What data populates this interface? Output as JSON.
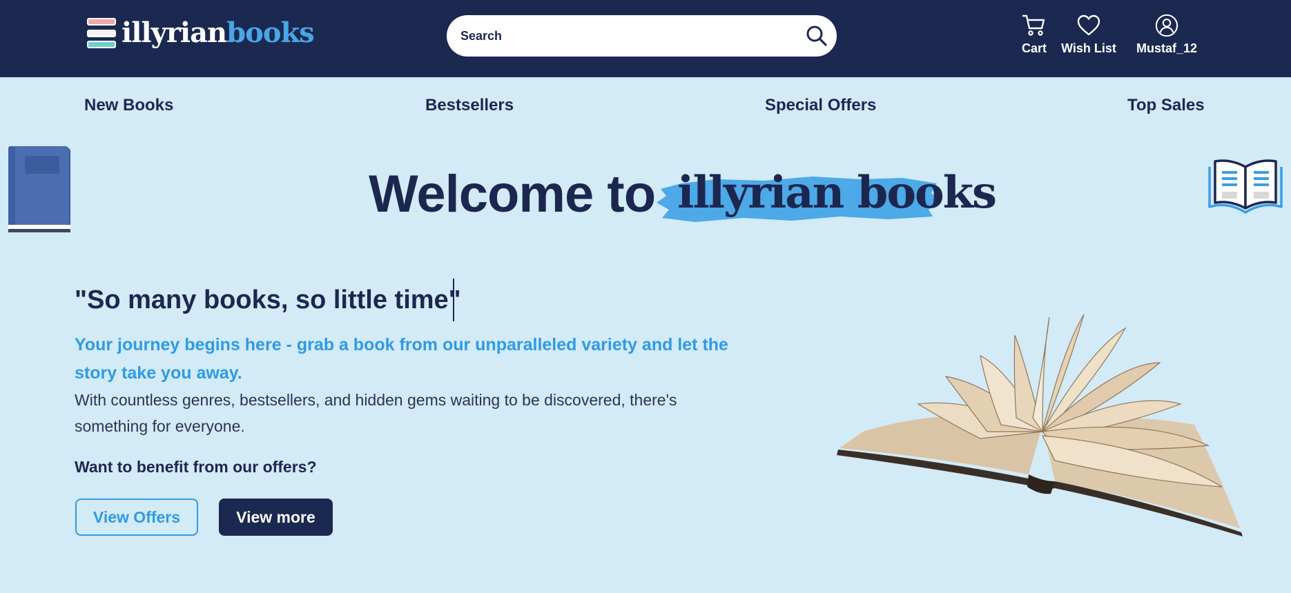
{
  "header": {
    "logo": {
      "part1": "illyrian",
      "part2": "books"
    },
    "search": {
      "placeholder": "Search"
    },
    "actions": {
      "cart": "Cart",
      "wishlist": "Wish List",
      "user": "Mustaf_12"
    }
  },
  "nav": {
    "items": [
      {
        "label": "New Books"
      },
      {
        "label": "Bestsellers"
      },
      {
        "label": "Special Offers"
      },
      {
        "label": "Top Sales"
      }
    ]
  },
  "hero": {
    "welcome_prefix": "Welcome to",
    "brand": "illyrian books",
    "quote": "\"So many books, so little time\"",
    "tagline": "Your journey begins here - grab a book from our unparalleled variety and let the story take you away.",
    "description": "With countless genres, bestsellers, and hidden gems waiting to be discovered, there's something for everyone.",
    "offer_question": "Want to benefit from our offers?",
    "view_offers_label": "View Offers",
    "view_more_label": "View more"
  },
  "icons": {
    "logo": "stacked-books-icon",
    "search": "search-icon",
    "cart": "cart-icon",
    "wishlist": "heart-icon",
    "user": "user-icon",
    "deco_left": "closed-book-icon",
    "deco_right": "open-book-icon",
    "hero_image": "open-book-illustration"
  },
  "colors": {
    "header_bg": "#1b2850",
    "page_bg": "#d3eaf7",
    "accent_blue": "#2e9be3",
    "brand_light_blue": "#48a6e6",
    "navy_text": "#1c2750"
  }
}
